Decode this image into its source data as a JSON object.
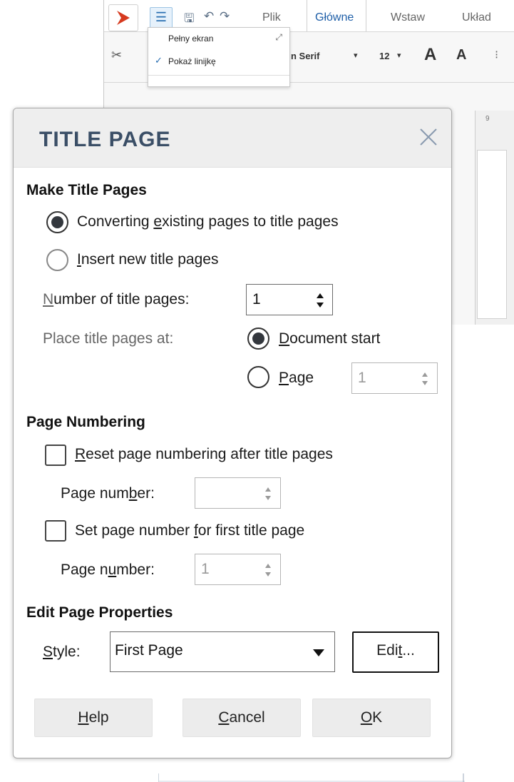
{
  "app": {
    "tabs": [
      "Plik",
      "Główne",
      "Wstaw",
      "Układ"
    ],
    "active_tab": "Główne",
    "font_name": "n Serif",
    "font_size": "12",
    "menu": {
      "items": [
        "Pełny ekran",
        "Pokaż linijkę"
      ]
    },
    "ruler_tick": "9"
  },
  "dialog": {
    "title": "TITLE PAGE",
    "make_title_pages": {
      "heading": "Make Title Pages",
      "option_convert": {
        "pre": "Converting ",
        "u": "e",
        "post": "xisting pages to title pages"
      },
      "option_insert": {
        "pre": "",
        "u": "I",
        "post": "nsert new title pages"
      },
      "number_label": {
        "pre": "",
        "u": "N",
        "post": "umber of title pages:"
      },
      "number_value": "1",
      "place_label": "Place title pages at:",
      "place_doc_start": {
        "pre": "",
        "u": "D",
        "post": "ocument start"
      },
      "place_page": {
        "pre": "",
        "u": "P",
        "post": "age"
      },
      "page_value": "1"
    },
    "page_numbering": {
      "heading": "Page Numbering",
      "reset_label": {
        "pre": "",
        "u": "R",
        "post": "eset page numbering after title pages"
      },
      "reset_page_number_label": {
        "pre": "Page num",
        "u": "b",
        "post": "er:"
      },
      "reset_page_number_value": "",
      "set_label": {
        "pre": "Set page number ",
        "u": "f",
        "post": "or first title page"
      },
      "set_page_number_label": {
        "pre": "Page n",
        "u": "u",
        "post": "mber:"
      },
      "set_page_number_value": "1"
    },
    "edit_page_properties": {
      "heading": "Edit Page Properties",
      "style_label": {
        "pre": "",
        "u": "S",
        "post": "tyle:"
      },
      "style_value": "First Page",
      "edit_button": {
        "pre": "Edi",
        "u": "t",
        "post": "..."
      }
    },
    "buttons": {
      "help": {
        "pre": "",
        "u": "H",
        "post": "elp"
      },
      "cancel": {
        "pre": "",
        "u": "C",
        "post": "ancel"
      },
      "ok": {
        "pre": "",
        "u": "O",
        "post": "K"
      }
    }
  }
}
